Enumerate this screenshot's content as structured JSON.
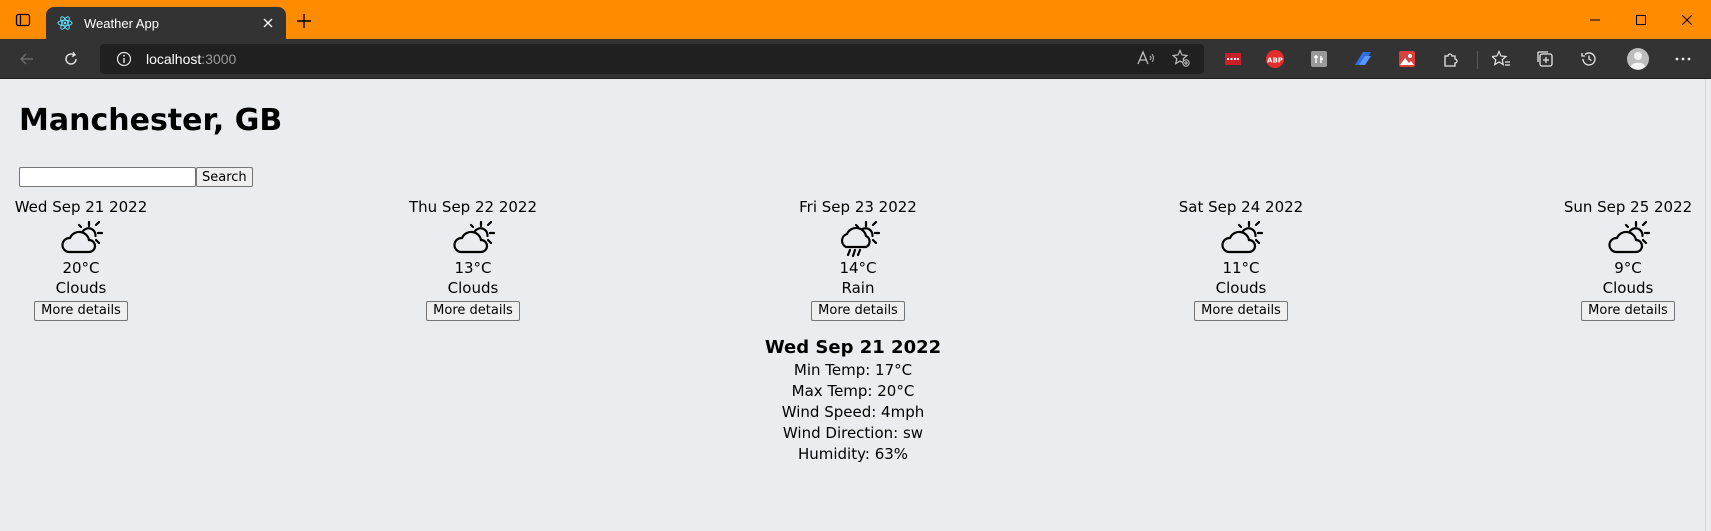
{
  "browser": {
    "tab_title": "Weather App",
    "url_host": "localhost",
    "url_port": ":3000"
  },
  "colors": {
    "titlebar": "#ff8c00",
    "toolbar": "#333333",
    "page_bg": "#ebecef"
  },
  "extensions": [
    "red-extension-icon",
    "adblock-plus-icon",
    "translate-extension-icon",
    "arrow-extension-icon",
    "picture-extension-icon",
    "puzzle-icon"
  ],
  "page": {
    "city": "Manchester, GB",
    "search": {
      "value": "",
      "button_label": "Search"
    },
    "forecast": [
      {
        "date": "Wed Sep 21 2022",
        "temp": "20°C",
        "condition": "Clouds",
        "icon": "partly-cloudy-icon",
        "button_label": "More details"
      },
      {
        "date": "Thu Sep 22 2022",
        "temp": "13°C",
        "condition": "Clouds",
        "icon": "partly-cloudy-icon",
        "button_label": "More details"
      },
      {
        "date": "Fri Sep 23 2022",
        "temp": "14°C",
        "condition": "Rain",
        "icon": "sun-rain-cloud-icon",
        "button_label": "More details"
      },
      {
        "date": "Sat Sep 24 2022",
        "temp": "11°C",
        "condition": "Clouds",
        "icon": "partly-cloudy-icon",
        "button_label": "More details"
      },
      {
        "date": "Sun Sep 25 2022",
        "temp": "9°C",
        "condition": "Clouds",
        "icon": "partly-cloudy-icon",
        "button_label": "More details"
      }
    ],
    "details": {
      "title": "Wed Sep 21 2022",
      "min_temp": "Min Temp: 17°C",
      "max_temp": "Max Temp: 20°C",
      "wind_speed": "Wind Speed: 4mph",
      "wind_direction": "Wind Direction: sw",
      "humidity": "Humidity: 63%"
    }
  }
}
